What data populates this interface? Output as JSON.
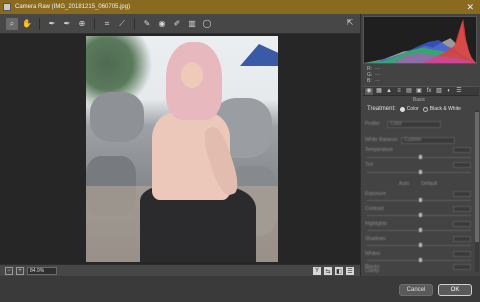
{
  "window": {
    "title": "Camera Raw (IMG_20181215_060705.jpg)",
    "close_glyph": "✕"
  },
  "toolbar": {
    "tools": [
      {
        "name": "zoom-tool",
        "glyph": "⌕"
      },
      {
        "name": "hand-tool",
        "glyph": "✋"
      },
      {
        "name": "white-balance-tool",
        "glyph": "✒"
      },
      {
        "name": "color-sampler-tool",
        "glyph": "✒"
      },
      {
        "name": "targeted-adjustment-tool",
        "glyph": "⊕"
      },
      {
        "name": "crop-tool",
        "glyph": "⌗"
      },
      {
        "name": "straighten-tool",
        "glyph": "⟋"
      },
      {
        "name": "spot-removal-tool",
        "glyph": "✎"
      },
      {
        "name": "red-eye-tool",
        "glyph": "◉"
      },
      {
        "name": "adjustment-brush-tool",
        "glyph": "✐"
      },
      {
        "name": "graduated-filter-tool",
        "glyph": "▥"
      },
      {
        "name": "radial-filter-tool",
        "glyph": "◯"
      }
    ],
    "open_preferences_glyph": "⇱"
  },
  "bottombar": {
    "zoom_value": "84.9%",
    "left_icon_1": "−",
    "left_icon_2": "+",
    "right_icon_1": "Y",
    "right_icon_2": "⇆",
    "right_icon_3": "◧",
    "right_icon_4": "☰"
  },
  "panel": {
    "rgb": [
      {
        "k": "R:",
        "v": "---"
      },
      {
        "k": "G:",
        "v": "---"
      },
      {
        "k": "B:",
        "v": "---"
      }
    ],
    "tabs": [
      "◉",
      "▦",
      "▲",
      "≡",
      "▤",
      "▣",
      "fx",
      "▧",
      "◐",
      "☰"
    ],
    "title": "Basic",
    "treatment_label": "Treatment:",
    "treatment_color": "Color",
    "treatment_bw": "Black & White",
    "profile_label": "Profile:",
    "profile_value": "Color",
    "wb_label": "White Balance:",
    "wb_value": "Custom",
    "temperature_label": "Temperature",
    "tint_label": "Tint",
    "auto_label": "Auto",
    "default_label": "Default",
    "exposure_label": "Exposure",
    "contrast_label": "Contrast",
    "highlights_label": "Highlights",
    "shadows_label": "Shadows",
    "whites_label": "Whites",
    "blacks_label": "Blacks",
    "clarity_label": "Clarity"
  },
  "footer": {
    "cancel_label": "Cancel",
    "ok_label": "OK"
  },
  "colors": {
    "title_bar": "#8a6a1e",
    "panel_bg": "#434343",
    "canvas_bg": "#262626"
  }
}
